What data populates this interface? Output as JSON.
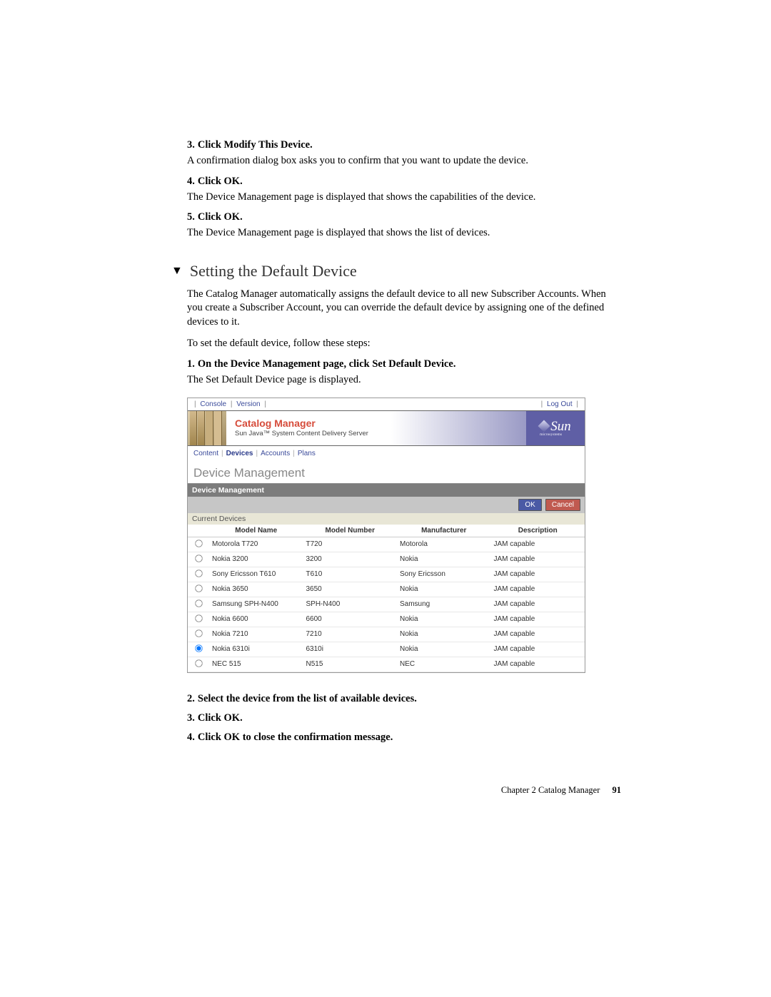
{
  "steps_before": [
    {
      "num": "3.",
      "label": "Click Modify This Device.",
      "body": "A confirmation dialog box asks you to confirm that you want to update the device."
    },
    {
      "num": "4.",
      "label": "Click OK.",
      "body": "The Device Management page is displayed that shows the capabilities of the device."
    },
    {
      "num": "5.",
      "label": "Click OK.",
      "body": "The Device Management page is displayed that shows the list of devices."
    }
  ],
  "section": {
    "title": "Setting the Default Device",
    "intro": "The Catalog Manager automatically assigns the default device to all new Subscriber Accounts. When you create a Subscriber Account, you can override the default device by assigning one of the defined devices to it.",
    "lead": "To set the default device, follow these steps:"
  },
  "steps_mid": [
    {
      "num": "1.",
      "label": "On the Device Management page, click Set Default Device.",
      "body": "The Set Default Device page is displayed."
    }
  ],
  "screenshot": {
    "topbar": {
      "console": "Console",
      "version": "Version",
      "logout": "Log Out"
    },
    "banner": {
      "title": "Catalog Manager",
      "subtitle": "Sun Java™ System Content Delivery Server",
      "brand": "Sun",
      "brand_sub": "microsystems"
    },
    "nav": {
      "content": "Content",
      "devices": "Devices",
      "accounts": "Accounts",
      "plans": "Plans"
    },
    "pagetitle": "Device Management",
    "panelhead": "Device Management",
    "buttons": {
      "ok": "OK",
      "cancel": "Cancel"
    },
    "subhead": "Current Devices",
    "columns": {
      "model_name": "Model Name",
      "model_number": "Model Number",
      "manufacturer": "Manufacturer",
      "description": "Description"
    },
    "rows": [
      {
        "model_name": "Motorola T720",
        "model_number": "T720",
        "manufacturer": "Motorola",
        "description": "JAM capable",
        "selected": false
      },
      {
        "model_name": "Nokia 3200",
        "model_number": "3200",
        "manufacturer": "Nokia",
        "description": "JAM capable",
        "selected": false
      },
      {
        "model_name": "Sony Ericsson T610",
        "model_number": "T610",
        "manufacturer": "Sony Ericsson",
        "description": "JAM capable",
        "selected": false
      },
      {
        "model_name": "Nokia 3650",
        "model_number": "3650",
        "manufacturer": "Nokia",
        "description": "JAM capable",
        "selected": false
      },
      {
        "model_name": "Samsung SPH-N400",
        "model_number": "SPH-N400",
        "manufacturer": "Samsung",
        "description": "JAM capable",
        "selected": false
      },
      {
        "model_name": "Nokia 6600",
        "model_number": "6600",
        "manufacturer": "Nokia",
        "description": "JAM capable",
        "selected": false
      },
      {
        "model_name": "Nokia 7210",
        "model_number": "7210",
        "manufacturer": "Nokia",
        "description": "JAM capable",
        "selected": false
      },
      {
        "model_name": "Nokia 6310i",
        "model_number": "6310i",
        "manufacturer": "Nokia",
        "description": "JAM capable",
        "selected": true
      },
      {
        "model_name": "NEC 515",
        "model_number": "N515",
        "manufacturer": "NEC",
        "description": "JAM capable",
        "selected": false
      }
    ]
  },
  "steps_after": [
    {
      "num": "2.",
      "label": "Select the device from the list of available devices.",
      "body": ""
    },
    {
      "num": "3.",
      "label": "Click OK.",
      "body": ""
    },
    {
      "num": "4.",
      "label": "Click OK to close the confirmation message.",
      "body": ""
    }
  ],
  "footer": {
    "chapter": "Chapter 2   Catalog Manager",
    "page": "91"
  }
}
